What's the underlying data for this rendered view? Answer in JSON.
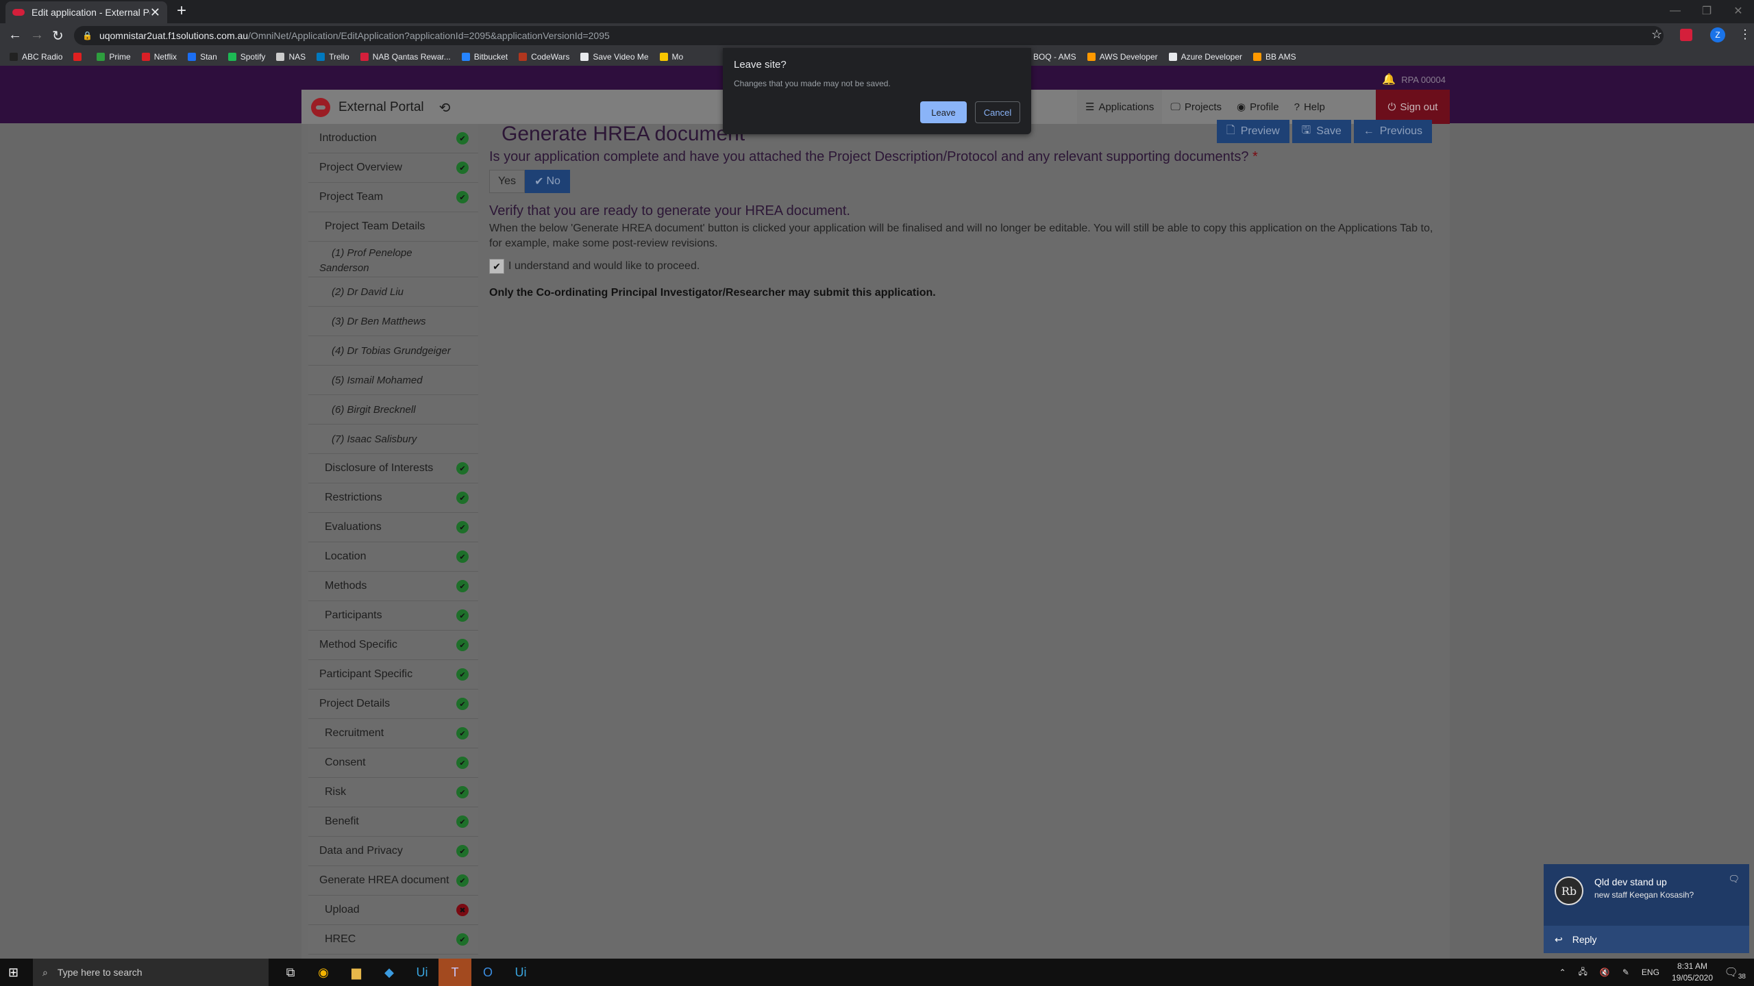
{
  "browser": {
    "tab_title": "Edit application - External Portal",
    "tab_close": "✕",
    "new_tab": "+",
    "window_controls": [
      "—",
      "❐",
      "✕"
    ],
    "url_host": "uqomnistar2uat.f1solutions.com.au",
    "url_path": "/OmniNet/Application/EditApplication?applicationId=2095&applicationVersionId=2095",
    "profile_letter": "Z",
    "bookmarks": [
      {
        "label": "ABC Radio",
        "color": "#222222"
      },
      {
        "label": "",
        "color": "#e02020"
      },
      {
        "label": "Prime",
        "color": "#2e9e3e"
      },
      {
        "label": "Netflix",
        "color": "#d81f26"
      },
      {
        "label": "Stan",
        "color": "#1b6ef3"
      },
      {
        "label": "Spotify",
        "color": "#1db954"
      },
      {
        "label": "NAS",
        "color": "#cccccc"
      },
      {
        "label": "Trello",
        "color": "#0079bf"
      },
      {
        "label": "NAB Qantas Rewar...",
        "color": "#d41f3b"
      },
      {
        "label": "Bitbucket",
        "color": "#2684ff"
      },
      {
        "label": "CodeWars",
        "color": "#b1361e"
      },
      {
        "label": "Save Video Me",
        "color": "#e8eaed"
      },
      {
        "label": "Mo",
        "color": "#f7c600"
      }
    ],
    "bookmarks_right": [
      {
        "label": "BOQ - AMS",
        "color": "#ff9900"
      },
      {
        "label": "AWS Developer",
        "color": "#ff9900"
      },
      {
        "label": "Azure Developer",
        "color": "#e8eaed"
      },
      {
        "label": "BB AMS",
        "color": "#ff9900"
      }
    ]
  },
  "dialog": {
    "title": "Leave site?",
    "message": "Changes that you made may not be saved.",
    "leave_label": "Leave",
    "cancel_label": "Cancel"
  },
  "header": {
    "user": "RPA 00004",
    "brand": "External Portal",
    "nav": [
      "Applications",
      "Projects",
      "Profile",
      "Help"
    ],
    "signout": "Sign out"
  },
  "sidebar": [
    {
      "label": "Introduction",
      "level": "top",
      "status": "ok"
    },
    {
      "label": "Project Overview",
      "level": "top",
      "status": "ok"
    },
    {
      "label": "Project Team",
      "level": "top",
      "status": "ok"
    },
    {
      "label": "Project Team Details",
      "level": "sub",
      "status": ""
    },
    {
      "label": "(1) Prof Penelope Sanderson",
      "level": "member2",
      "status": ""
    },
    {
      "label": "(2) Dr David Liu",
      "level": "member",
      "status": ""
    },
    {
      "label": "(3) Dr Ben Matthews",
      "level": "member",
      "status": ""
    },
    {
      "label": "(4) Dr Tobias Grundgeiger",
      "level": "member",
      "status": ""
    },
    {
      "label": "(5) Ismail Mohamed",
      "level": "member",
      "status": ""
    },
    {
      "label": "(6) Birgit Brecknell",
      "level": "member",
      "status": ""
    },
    {
      "label": "(7) Isaac Salisbury",
      "level": "member",
      "status": ""
    },
    {
      "label": "Disclosure of Interests",
      "level": "sub",
      "status": "ok"
    },
    {
      "label": "Restrictions",
      "level": "sub",
      "status": "ok"
    },
    {
      "label": "Evaluations",
      "level": "sub",
      "status": "ok"
    },
    {
      "label": "Location",
      "level": "sub",
      "status": "ok"
    },
    {
      "label": "Methods",
      "level": "sub",
      "status": "ok"
    },
    {
      "label": "Participants",
      "level": "sub",
      "status": "ok"
    },
    {
      "label": "Method Specific",
      "level": "top",
      "status": "ok"
    },
    {
      "label": "Participant Specific",
      "level": "top",
      "status": "ok"
    },
    {
      "label": "Project Details",
      "level": "top",
      "status": "ok"
    },
    {
      "label": "Recruitment",
      "level": "sub",
      "status": "ok"
    },
    {
      "label": "Consent",
      "level": "sub",
      "status": "ok"
    },
    {
      "label": "Risk",
      "level": "sub",
      "status": "ok"
    },
    {
      "label": "Benefit",
      "level": "sub",
      "status": "ok"
    },
    {
      "label": "Data and Privacy",
      "level": "top",
      "status": "ok"
    },
    {
      "label": "Generate HREA document",
      "level": "top",
      "status": "ok"
    },
    {
      "label": "Upload",
      "level": "sub",
      "status": "bad"
    },
    {
      "label": "HREC",
      "level": "sub",
      "status": "ok"
    }
  ],
  "main": {
    "title": "Generate HREA document",
    "actions": [
      "Preview",
      "Save",
      "Previous"
    ],
    "question": "Is your application complete and have you attached the Project Description/Protocol and any relevant supporting documents?",
    "required_mark": "*",
    "yes_label": "Yes",
    "no_label": "No",
    "verify_heading": "Verify that you are ready to generate your HREA document.",
    "verify_text": "When the below 'Generate HREA document' button is clicked your application will be finalised and will no longer be editable. You will still be able to copy this application on the Applications Tab to, for example, make some post-review revisions.",
    "checkbox_label": "I understand and would like to proceed.",
    "checkbox_checked": true,
    "note": "Only the Co-ordinating Principal Investigator/Researcher may submit this application."
  },
  "toast": {
    "avatar_initials": "Rb",
    "title": "Qld dev stand up",
    "message": "new staff Keegan Kosasih?",
    "reply_label": "Reply"
  },
  "taskbar": {
    "search_placeholder": "Type here to search",
    "language": "ENG",
    "time": "8:31 AM",
    "date": "19/05/2020",
    "notification_count": "38"
  }
}
